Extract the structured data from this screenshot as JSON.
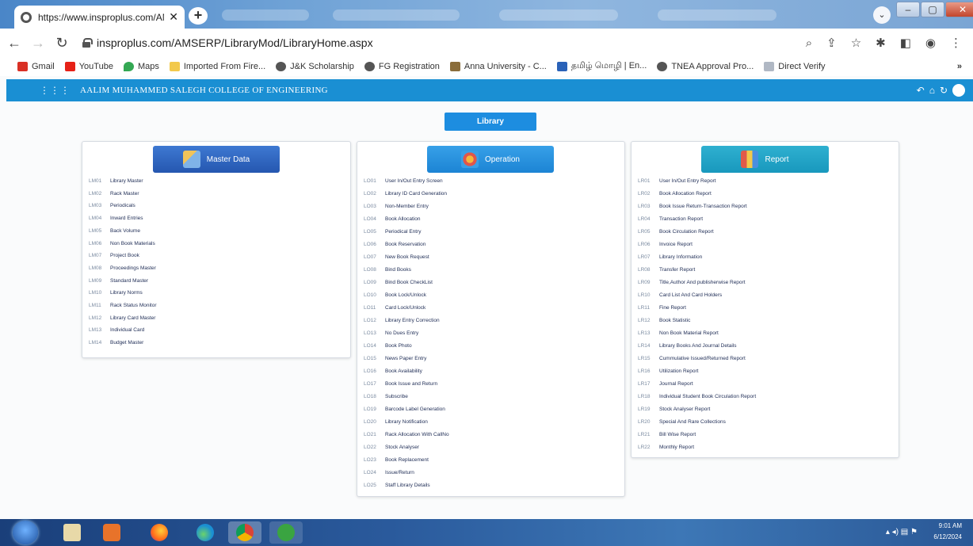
{
  "browser": {
    "tab_title": "https://www.insproplus.com/AM",
    "url": "insproplus.com/AMSERP/LibraryMod/LibraryHome.aspx",
    "bookmarks": [
      "Gmail",
      "YouTube",
      "Maps",
      "Imported From Fire...",
      "J&K Scholarship",
      "FG Registration",
      "Anna University - C...",
      "தமிழ் மொழி | En...",
      "TNEA Approval Pro...",
      "Direct Verify"
    ],
    "bookmarks_more": "»"
  },
  "app": {
    "title": "AALIM MUHAMMED SALEGH COLLEGE OF ENGINEERING",
    "library_label": "Library"
  },
  "panels": {
    "master": {
      "title": "Master Data",
      "items": [
        {
          "code": "LM01",
          "label": "Library Master"
        },
        {
          "code": "LM02",
          "label": "Rack Master"
        },
        {
          "code": "LM03",
          "label": "Periodicals"
        },
        {
          "code": "LM04",
          "label": "Inward Entries"
        },
        {
          "code": "LM05",
          "label": "Back Volume"
        },
        {
          "code": "LM06",
          "label": "Non Book Materials"
        },
        {
          "code": "LM07",
          "label": "Project Book"
        },
        {
          "code": "LM08",
          "label": "Proceedings Master"
        },
        {
          "code": "LM09",
          "label": "Standard Master"
        },
        {
          "code": "LM10",
          "label": "Library Norms"
        },
        {
          "code": "LM11",
          "label": "Rack Status Monitor"
        },
        {
          "code": "LM12",
          "label": "Library Card Master"
        },
        {
          "code": "LM13",
          "label": "Individual Card"
        },
        {
          "code": "LM14",
          "label": "Budget Master"
        }
      ]
    },
    "operation": {
      "title": "Operation",
      "items": [
        {
          "code": "LO01",
          "label": "User In/Out Entry Screen"
        },
        {
          "code": "LO02",
          "label": "Library ID Card Generation"
        },
        {
          "code": "LO03",
          "label": "Non-Member Entry"
        },
        {
          "code": "LO04",
          "label": "Book Allocation"
        },
        {
          "code": "LO05",
          "label": "Periodical Entry"
        },
        {
          "code": "LO06",
          "label": "Book Reservation"
        },
        {
          "code": "LO07",
          "label": "New Book Request"
        },
        {
          "code": "LO08",
          "label": "Bind Books"
        },
        {
          "code": "LO09",
          "label": "Bind Book CheckList"
        },
        {
          "code": "LO10",
          "label": "Book Lock/Unlock"
        },
        {
          "code": "LO11",
          "label": "Card Lock/Unlock"
        },
        {
          "code": "LO12",
          "label": "Library Entry Correction"
        },
        {
          "code": "LO13",
          "label": "No Dues Entry"
        },
        {
          "code": "LO14",
          "label": "Book Photo"
        },
        {
          "code": "LO15",
          "label": "News Paper Entry"
        },
        {
          "code": "LO16",
          "label": "Book Availability"
        },
        {
          "code": "LO17",
          "label": "Book Issue and Return"
        },
        {
          "code": "LO18",
          "label": "Subscribe"
        },
        {
          "code": "LO19",
          "label": "Barcode Label Generation"
        },
        {
          "code": "LO20",
          "label": "Library Notification"
        },
        {
          "code": "LO21",
          "label": "Rack Allocation With CallNo"
        },
        {
          "code": "LO22",
          "label": "Stock Analyser"
        },
        {
          "code": "LO23",
          "label": "Book Replacement"
        },
        {
          "code": "LO24",
          "label": "Issue/Return"
        },
        {
          "code": "LO25",
          "label": "Staff Library Details"
        }
      ]
    },
    "report": {
      "title": "Report",
      "items": [
        {
          "code": "LR01",
          "label": "User In/Out Entry Report"
        },
        {
          "code": "LR02",
          "label": "Book Allocation Report"
        },
        {
          "code": "LR03",
          "label": "Book Issue Return-Transaction Report"
        },
        {
          "code": "LR04",
          "label": "Transaction Report"
        },
        {
          "code": "LR05",
          "label": "Book Circulation Report"
        },
        {
          "code": "LR06",
          "label": "Invoice Report"
        },
        {
          "code": "LR07",
          "label": "Library Information"
        },
        {
          "code": "LR08",
          "label": "Transfer Report"
        },
        {
          "code": "LR09",
          "label": "Title,Author And publisherwise Report"
        },
        {
          "code": "LR10",
          "label": "Card List And Card Holders"
        },
        {
          "code": "LR11",
          "label": "Fine Report"
        },
        {
          "code": "LR12",
          "label": "Book Statistic"
        },
        {
          "code": "LR13",
          "label": "Non Book Material Report"
        },
        {
          "code": "LR14",
          "label": "Library Books And Journal Details"
        },
        {
          "code": "LR15",
          "label": "Cummulative Issued/Returned Report"
        },
        {
          "code": "LR16",
          "label": "Utilization Report"
        },
        {
          "code": "LR17",
          "label": "Journal Report"
        },
        {
          "code": "LR18",
          "label": "Individual Student Book Circulation Report"
        },
        {
          "code": "LR19",
          "label": "Stock Analyser Report"
        },
        {
          "code": "LR20",
          "label": "Special And Rare Collections"
        },
        {
          "code": "LR21",
          "label": "Bill Wise Report"
        },
        {
          "code": "LR22",
          "label": "Monthly Report"
        }
      ]
    }
  },
  "taskbar": {
    "time": "9:01 AM",
    "date": "6/12/2024"
  }
}
